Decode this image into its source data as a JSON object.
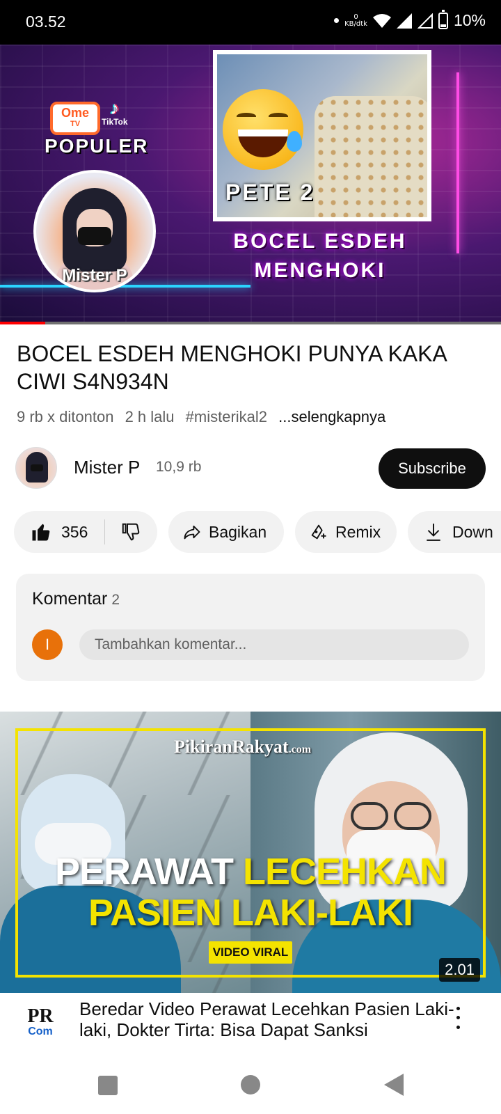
{
  "status_bar": {
    "time": "03.52",
    "net_speed_value": "0",
    "net_speed_unit": "KB/dtk",
    "battery": "10%",
    "icons": [
      "notification-dot-icon",
      "wifi-icon",
      "signal-icon",
      "signal-empty-icon",
      "battery-icon"
    ]
  },
  "player": {
    "thumbnail_text": {
      "ome_logo": "Ome",
      "ome_logo_sub": "TV",
      "tiktok_logo": "TikTok",
      "populer": "POPULER",
      "avatar_name": "Mister P",
      "pete": "PETE 2",
      "caption_line1": "BOCEL ESDEH",
      "caption_line2": "MENGHOKI"
    },
    "progress": 0.09
  },
  "video": {
    "title": "BOCEL ESDEH MENGHOKI PUNYA KAKA CIWI S4N934N",
    "views": "9 rb x ditonton",
    "age": "2 h lalu",
    "hashtag": "#misterikal2",
    "more": "...selengkapnya"
  },
  "channel": {
    "name": "Mister P",
    "subscribers": "10,9 rb",
    "subscribe_label": "Subscribe"
  },
  "actions": {
    "like_count": "356",
    "share_label": "Bagikan",
    "remix_label": "Remix",
    "download_label": "Down"
  },
  "comments": {
    "label": "Komentar",
    "count": "2",
    "user_initial": "I",
    "placeholder": "Tambahkan komentar..."
  },
  "next_video": {
    "thumbnail_text": {
      "brand": "PikiranRakyat",
      "brand_suffix": ".com",
      "headline_white": "PERAWAT",
      "headline_yellow": "LECEHKAN",
      "headline_line2": "PASIEN LAKI-LAKI",
      "tag": "VIDEO VIRAL"
    },
    "duration": "2.01",
    "channel_logo_top": "PR",
    "channel_logo_bottom": "Com",
    "title": "Beredar Video Perawat Lecehkan Pasien Laki-laki, Dokter Tirta: Bisa Dapat Sanksi"
  },
  "colors": {
    "accent_red": "#ff0000",
    "subscribe_bg": "#0f0f0f",
    "user_avatar": "#e8710a",
    "thumbnail_yellow": "#f4e300"
  }
}
